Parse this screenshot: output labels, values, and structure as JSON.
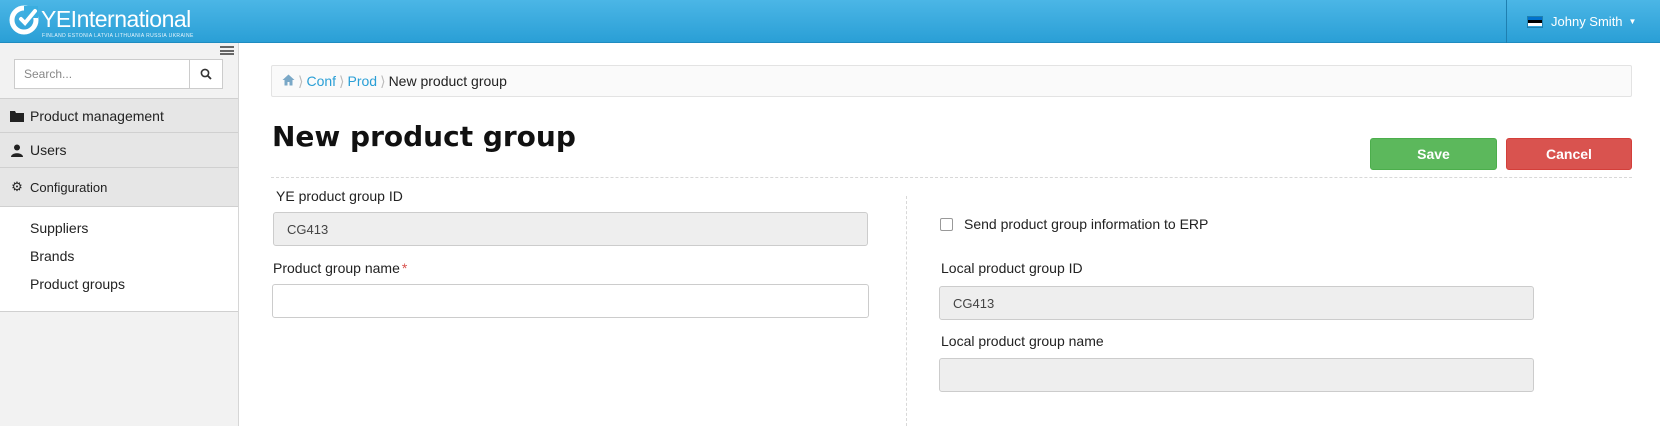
{
  "header": {
    "logo_text": "YEInternational",
    "logo_subtext": "FINLAND  ESTONIA  LATVIA  LITHUANIA  RUSSIA  UKRAINE",
    "user_name": "Johny Smith",
    "flag_colors": [
      "#0072ce",
      "#000000",
      "#ffffff"
    ],
    "accent": "#2a9fd6"
  },
  "sidebar": {
    "search_placeholder": "Search...",
    "items": [
      {
        "label": "Product management",
        "icon": "folder-icon"
      },
      {
        "label": "Users",
        "icon": "user-icon"
      },
      {
        "label": "Configuration",
        "icon": "gear-icon"
      }
    ],
    "subitems": [
      {
        "label": "Suppliers"
      },
      {
        "label": "Brands"
      },
      {
        "label": "Product groups"
      }
    ]
  },
  "breadcrumb": {
    "items": [
      "Conf",
      "Prod"
    ],
    "current": "New product group"
  },
  "page": {
    "title": "New product group",
    "save_label": "Save",
    "cancel_label": "Cancel"
  },
  "form": {
    "ye_id_label": "YE product group ID",
    "ye_id_value": "CG413",
    "name_label": "Product group name",
    "name_required": "*",
    "name_value": "",
    "erp_label": "Send product group information to ERP",
    "erp_checked": false,
    "local_id_label": "Local product group ID",
    "local_id_value": "CG413",
    "local_name_label": "Local product group name",
    "local_name_value": ""
  }
}
